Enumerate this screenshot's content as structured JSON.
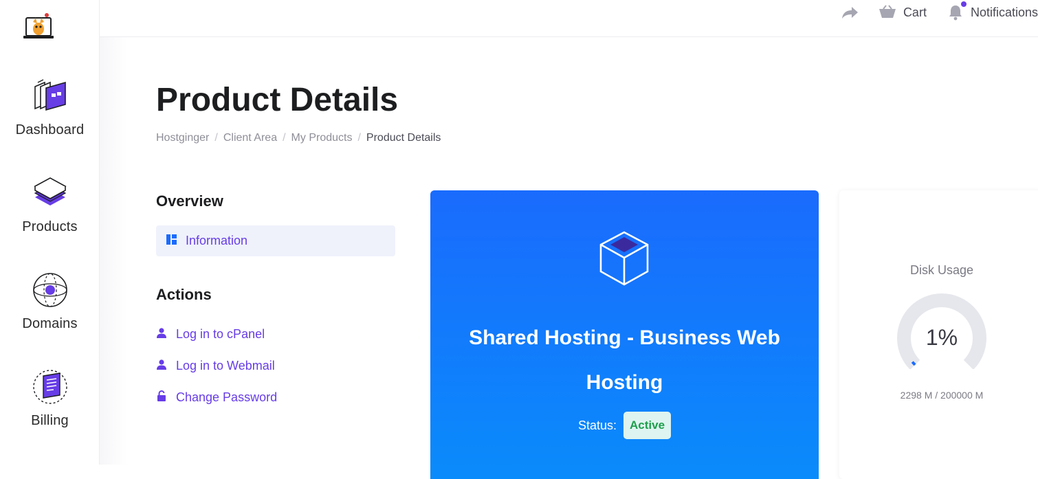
{
  "sidebar": {
    "items": [
      {
        "label": "Dashboard",
        "icon": "dashboard-icon"
      },
      {
        "label": "Products",
        "icon": "products-icon"
      },
      {
        "label": "Domains",
        "icon": "domains-icon"
      },
      {
        "label": "Billing",
        "icon": "billing-icon"
      }
    ]
  },
  "topbar": {
    "cart_label": "Cart",
    "notifications_label": "Notifications"
  },
  "page": {
    "title": "Product Details",
    "breadcrumb": [
      "Hostginger",
      "Client Area",
      "My Products",
      "Product Details"
    ]
  },
  "overview": {
    "heading": "Overview",
    "info_label": "Information"
  },
  "actions": {
    "heading": "Actions",
    "items": [
      {
        "label": "Log in to cPanel",
        "icon": "user-icon"
      },
      {
        "label": "Log in to Webmail",
        "icon": "user-icon"
      },
      {
        "label": "Change Password",
        "icon": "lock-icon"
      }
    ]
  },
  "product": {
    "name": "Shared Hosting - Business Web Hosting",
    "status_label": "Status:",
    "status_value": "Active"
  },
  "disk": {
    "title": "Disk Usage",
    "percent_text": "1%",
    "percent": 1,
    "usage_text": "2298 M / 200000 M"
  },
  "colors": {
    "accent": "#673de6",
    "card_top": "#1a6bfd",
    "card_bottom": "#0a8bfb",
    "status_bg": "#def4f0",
    "status_fg": "#1e9e4b"
  }
}
